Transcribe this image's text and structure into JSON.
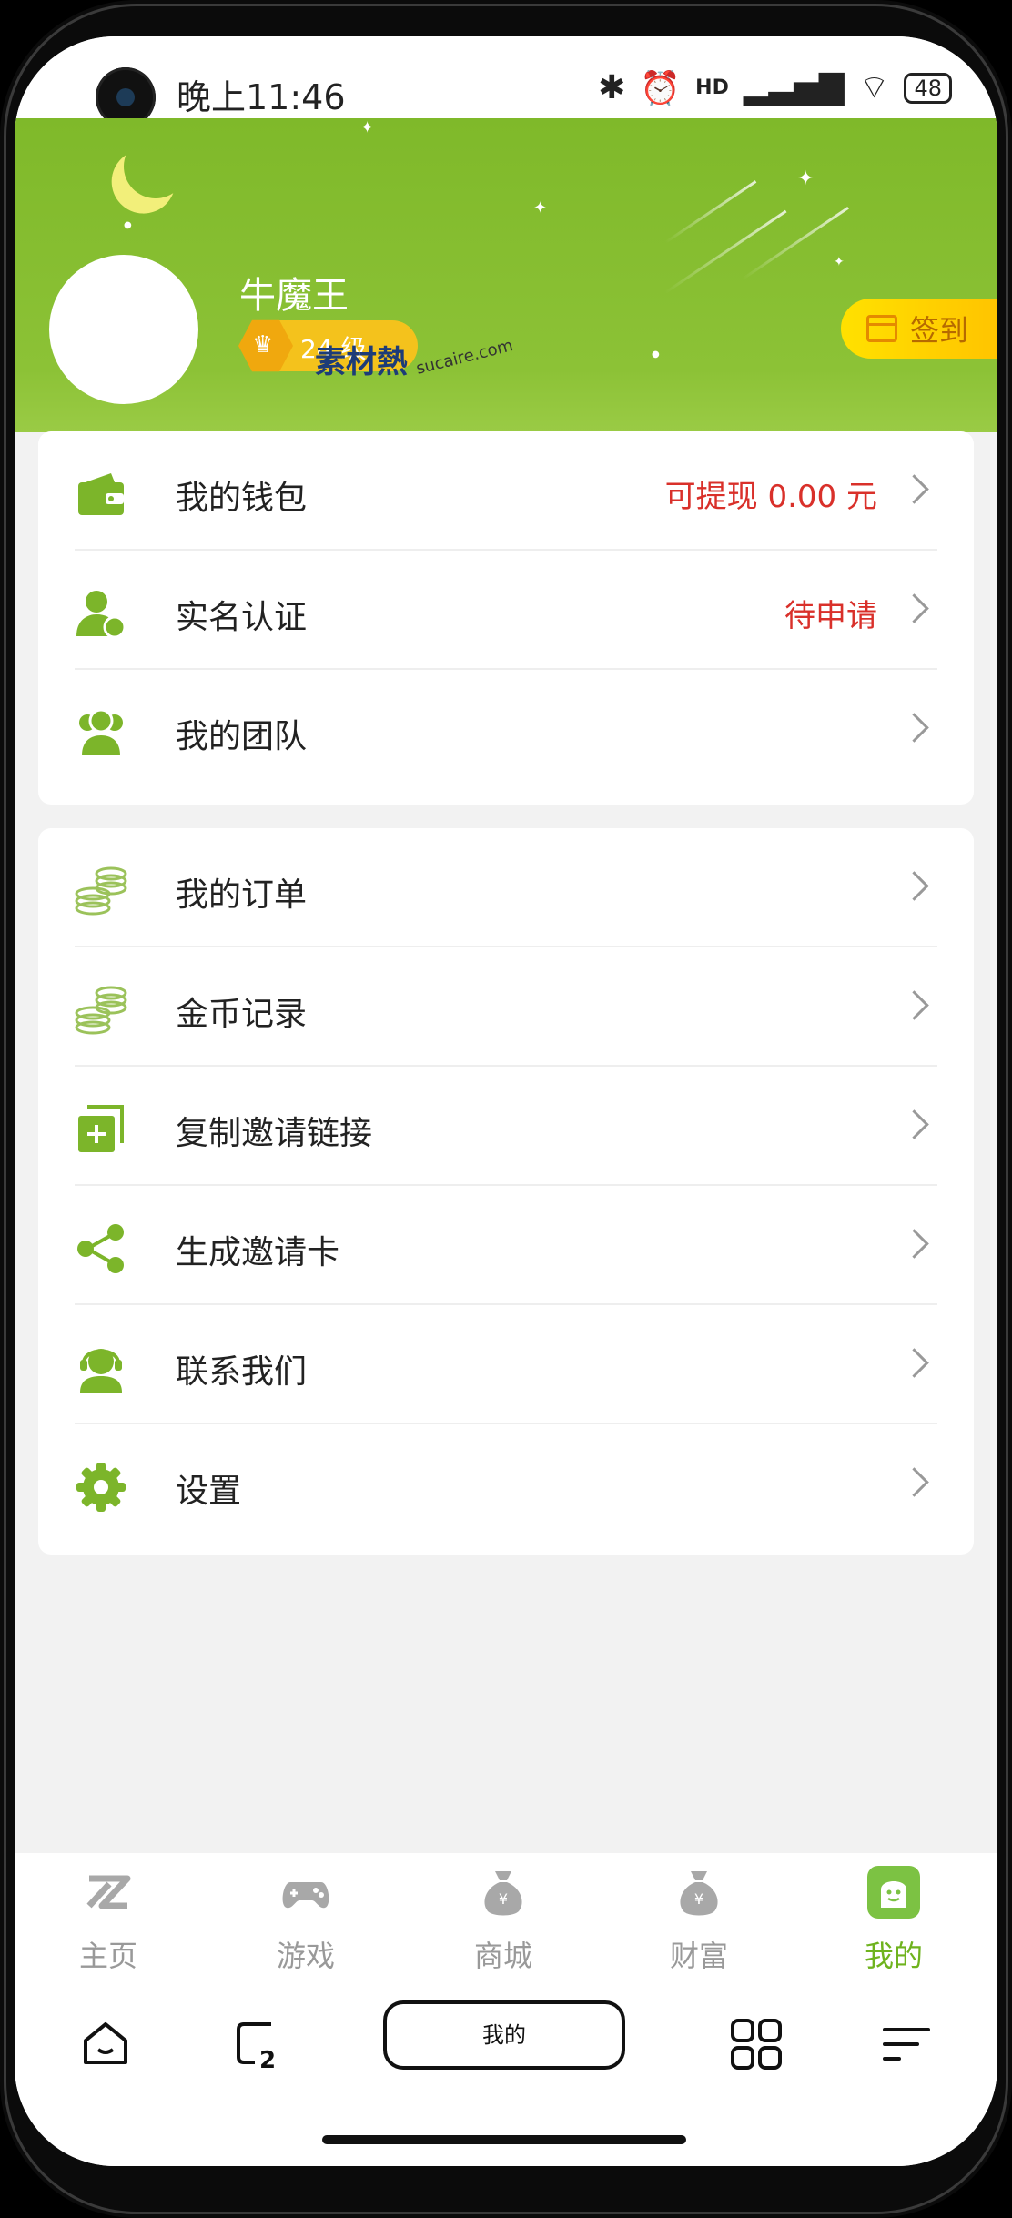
{
  "status_bar": {
    "time": "晚上11:46",
    "battery": "48",
    "network": "HD"
  },
  "profile": {
    "username": "牛魔王",
    "level": "24 级",
    "checkin_label": "签到",
    "watermark": "素材熱",
    "watermark_url": "sucaire.com"
  },
  "colors": {
    "brand_green": "#8cc236",
    "accent_red": "#d9302a",
    "checkin_yellow": "#ffd500"
  },
  "menu_group_1": [
    {
      "label": "我的钱包",
      "value": "可提现 0.00 元",
      "icon": "wallet-icon"
    },
    {
      "label": "实名认证",
      "value": "待申请",
      "icon": "user-verify-icon"
    },
    {
      "label": "我的团队",
      "value": "",
      "icon": "team-icon"
    }
  ],
  "menu_group_2": [
    {
      "label": "我的订单",
      "icon": "coins-icon"
    },
    {
      "label": "金币记录",
      "icon": "coins-icon"
    },
    {
      "label": "复制邀请链接",
      "icon": "copy-add-icon"
    },
    {
      "label": "生成邀请卡",
      "icon": "share-icon"
    },
    {
      "label": "联系我们",
      "icon": "support-icon"
    },
    {
      "label": "设置",
      "icon": "gear-icon"
    }
  ],
  "tabs": [
    {
      "label": "主页",
      "icon": "home-z-icon"
    },
    {
      "label": "游戏",
      "icon": "gamepad-icon"
    },
    {
      "label": "商城",
      "icon": "money-bag-icon"
    },
    {
      "label": "财富",
      "icon": "money-bag-icon"
    },
    {
      "label": "我的",
      "icon": "profile-face-icon",
      "active": true
    }
  ],
  "system_nav": {
    "current_app_label": "我的"
  }
}
